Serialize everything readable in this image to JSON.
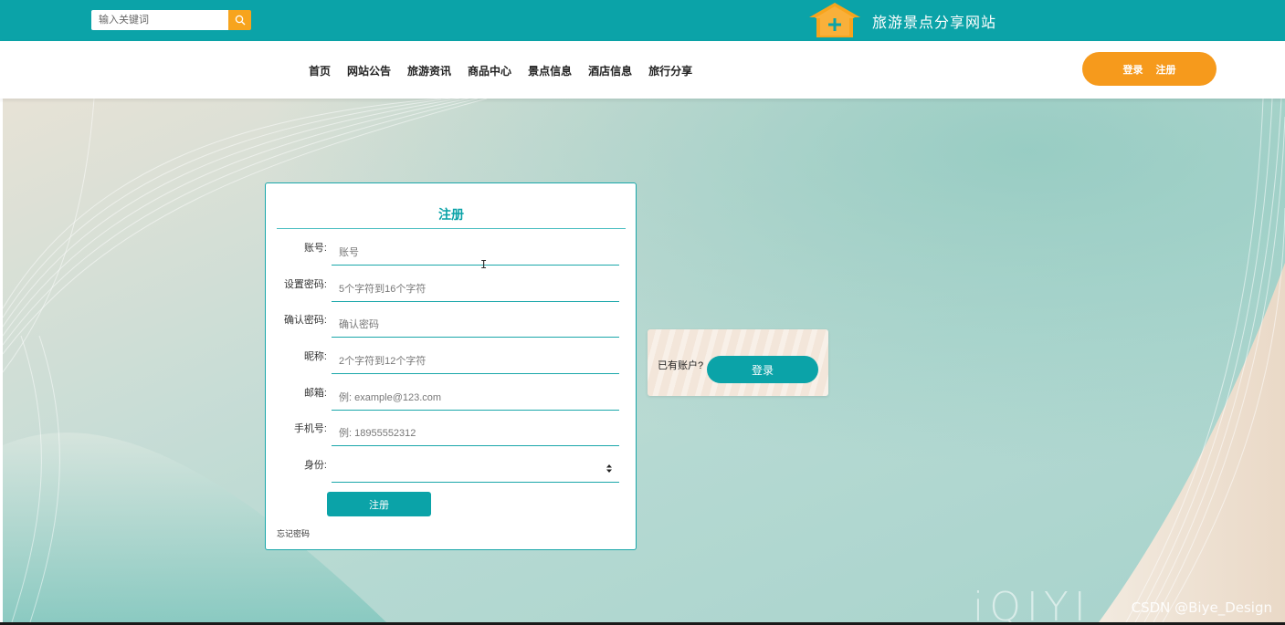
{
  "header": {
    "search_placeholder": "输入关键词",
    "site_title": "旅游景点分享网站",
    "brand_color": "#0ba3a8",
    "accent_color": "#f7a41d"
  },
  "nav": {
    "items": [
      "首页",
      "网站公告",
      "旅游资讯",
      "商品中心",
      "景点信息",
      "酒店信息",
      "旅行分享"
    ],
    "login_label": "登录",
    "register_label": "注册"
  },
  "register": {
    "title": "注册",
    "fields": [
      {
        "label": "账号:",
        "placeholder": "账号"
      },
      {
        "label": "设置密码:",
        "placeholder": "5个字符到16个字符"
      },
      {
        "label": "确认密码:",
        "placeholder": "确认密码"
      },
      {
        "label": "昵称:",
        "placeholder": "2个字符到12个字符"
      },
      {
        "label": "邮箱:",
        "placeholder": "例: example@123.com"
      },
      {
        "label": "手机号:",
        "placeholder": "例: 18955552312"
      },
      {
        "label": "身份:",
        "value": ""
      }
    ],
    "submit_label": "注册",
    "forgot_label": "忘记密码"
  },
  "login_prompt": {
    "question": "已有账户?",
    "button_label": "登录"
  },
  "watermarks": {
    "csdn": "CSDN @Biye_Design",
    "iqiyi": "iQIYI"
  }
}
